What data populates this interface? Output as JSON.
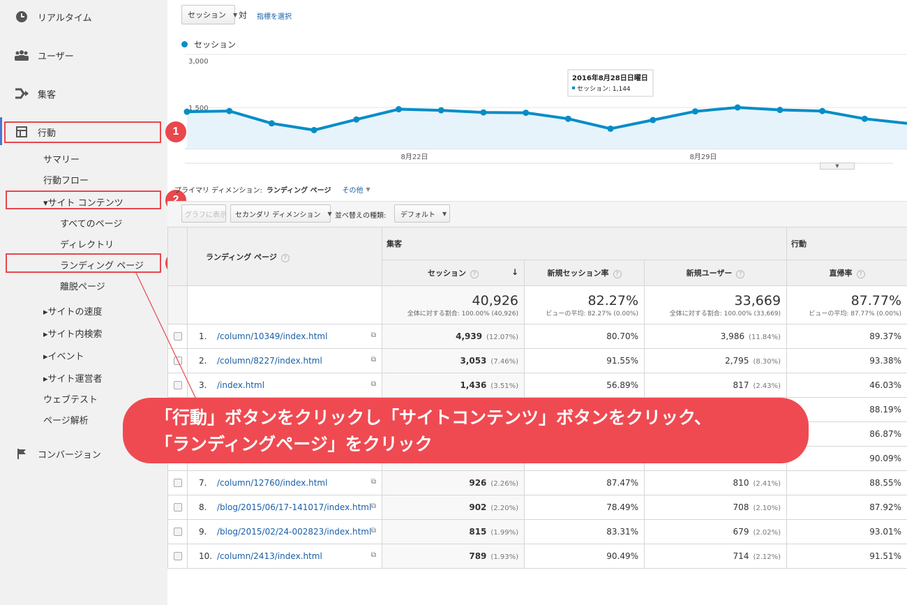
{
  "sidebar": {
    "realtime": "リアルタイム",
    "users": "ユーザー",
    "acquisition": "集客",
    "behavior": "行動",
    "summary": "サマリー",
    "flow": "行動フロー",
    "site_content": "▾サイト コンテンツ",
    "all_pages": "すべてのページ",
    "directory": "ディレクトリ",
    "landing_pages": "ランディング ページ",
    "exit_pages": "離脱ページ",
    "site_speed": "▸サイトの速度",
    "site_search": "▸サイト内検索",
    "events": "▸イベント",
    "publisher": "▸サイト運営者",
    "experiments": "ウェブテスト",
    "page_analytics": "ページ解析",
    "conversions": "コンバージョン"
  },
  "badges": [
    "1",
    "2",
    "3"
  ],
  "toolbar": {
    "metric": "セッション",
    "vs": "対",
    "choose_metric": "指標を選択"
  },
  "chart_data": {
    "type": "line",
    "legend": "セッション",
    "yticks": [
      "3,000",
      "1,500"
    ],
    "ylim": [
      0,
      3000
    ],
    "xlabels": [
      "8月22日",
      "8月29日"
    ],
    "values": [
      1380,
      1400,
      1050,
      860,
      1160,
      1450,
      1420,
      1360,
      1350,
      1180,
      900,
      1144,
      1390,
      1500,
      1430,
      1400,
      1180,
      1050
    ],
    "tooltip": {
      "date": "2016年8月28日日曜日",
      "label": "セッション: 1,144"
    },
    "color": "#058dc7"
  },
  "dimension": {
    "label": "プライマリ ディメンション:",
    "value": "ランディング ページ",
    "other": "その他"
  },
  "controls": {
    "graph_btn": "グラフに表示",
    "secondary": "セカンダリ ディメンション",
    "sort_label": "並べ替えの種類:",
    "sort_value": "デフォルト"
  },
  "table": {
    "col_landing": "ランディング ページ",
    "group_acq": "集客",
    "group_beh": "行動",
    "col_sessions": "セッション",
    "col_new_rate": "新規セッション率",
    "col_new_users": "新規ユーザー",
    "col_bounce": "直帰率",
    "totals": {
      "sessions": "40,926",
      "sessions_sub": "全体に対する割合: 100.00% (40,926)",
      "new_rate": "82.27%",
      "new_rate_sub": "ビューの平均: 82.27% (0.00%)",
      "new_users": "33,669",
      "new_users_sub": "全体に対する割合: 100.00% (33,669)",
      "bounce": "87.77%",
      "bounce_sub": "ビューの平均: 87.77% (0.00%)"
    },
    "rows": [
      {
        "num": "1.",
        "page": "/column/10349/index.html",
        "sessions": "4,939",
        "sp": "(12.07%)",
        "rate": "80.70%",
        "users": "3,986",
        "up": "(11.84%)",
        "bounce": "89.37%"
      },
      {
        "num": "2.",
        "page": "/column/8227/index.html",
        "sessions": "3,053",
        "sp": "(7.46%)",
        "rate": "91.55%",
        "users": "2,795",
        "up": "(8.30%)",
        "bounce": "93.38%"
      },
      {
        "num": "3.",
        "page": "/index.html",
        "sessions": "1,436",
        "sp": "(3.51%)",
        "rate": "56.89%",
        "users": "817",
        "up": "(2.43%)",
        "bounce": "46.03%"
      },
      {
        "num": "",
        "page": "",
        "sessions": "",
        "sp": "",
        "rate": "",
        "users": "",
        "up": "",
        "bounce": "88.19%"
      },
      {
        "num": "",
        "page": "",
        "sessions": "",
        "sp": "",
        "rate": "",
        "users": "",
        "up": "",
        "bounce": "86.87%"
      },
      {
        "num": "",
        "page": "",
        "sessions": "",
        "sp": "",
        "rate": "",
        "users": "",
        "up": "",
        "bounce": "90.09%"
      },
      {
        "num": "7.",
        "page": "/column/12760/index.html",
        "sessions": "926",
        "sp": "(2.26%)",
        "rate": "87.47%",
        "users": "810",
        "up": "(2.41%)",
        "bounce": "88.55%"
      },
      {
        "num": "8.",
        "page": "/blog/2015/06/17-141017/index.html",
        "sessions": "902",
        "sp": "(2.20%)",
        "rate": "78.49%",
        "users": "708",
        "up": "(2.10%)",
        "bounce": "87.92%"
      },
      {
        "num": "9.",
        "page": "/blog/2015/02/24-002823/index.html",
        "sessions": "815",
        "sp": "(1.99%)",
        "rate": "83.31%",
        "users": "679",
        "up": "(2.02%)",
        "bounce": "93.01%"
      },
      {
        "num": "10.",
        "page": "/column/2413/index.html",
        "sessions": "789",
        "sp": "(1.93%)",
        "rate": "90.49%",
        "users": "714",
        "up": "(2.12%)",
        "bounce": "91.51%"
      }
    ]
  },
  "callout": {
    "line1": "「行動」ボタンをクリックし「サイトコンテンツ」ボタンをクリック、",
    "line2": "「ランディングページ」をクリック"
  }
}
